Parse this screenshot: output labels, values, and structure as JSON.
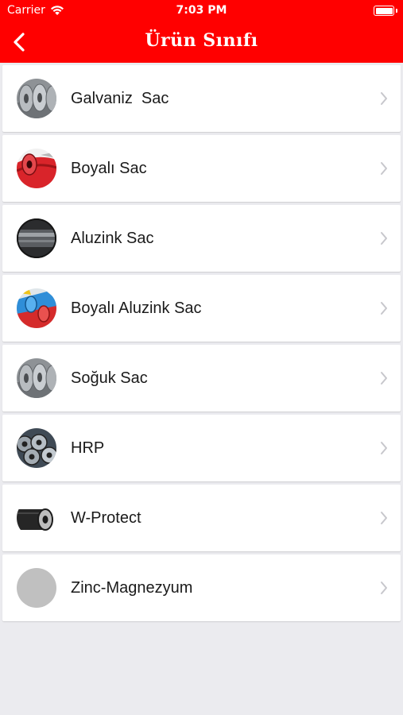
{
  "status_bar": {
    "carrier": "Carrier",
    "time": "7:03 PM"
  },
  "nav": {
    "title": "Ürün Sınıfı",
    "back_icon": "chevron-left-icon"
  },
  "colors": {
    "accent": "#ff0000",
    "background": "#ebebef",
    "row": "#ffffff",
    "chevron": "#c7c7cc",
    "placeholder": "#c0c0c0"
  },
  "products": [
    {
      "name": "Galvaniz  Sac",
      "thumb": "steel-coils"
    },
    {
      "name": "Boyalı Sac",
      "thumb": "red-painted-coil"
    },
    {
      "name": "Aluzink Sac",
      "thumb": "dark-metal-coil"
    },
    {
      "name": "Boyalı Aluzink Sac",
      "thumb": "blue-red-painted-coils"
    },
    {
      "name": "Soğuk Sac",
      "thumb": "steel-coils"
    },
    {
      "name": "HRP",
      "thumb": "steel-coil-stack"
    },
    {
      "name": "W-Protect",
      "thumb": "black-coil"
    },
    {
      "name": "Zinc-Magnezyum",
      "thumb": "placeholder"
    }
  ]
}
